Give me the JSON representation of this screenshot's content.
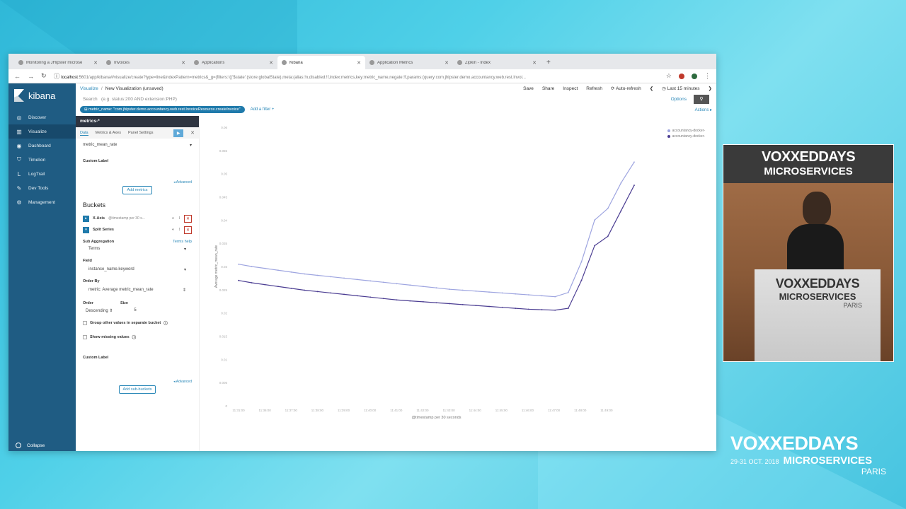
{
  "browser": {
    "tabs": [
      {
        "title": "Monitoring a JHipster microse",
        "active": false
      },
      {
        "title": "Invoices",
        "active": false
      },
      {
        "title": "Applications",
        "active": false
      },
      {
        "title": "Kibana",
        "active": true
      },
      {
        "title": "Application Metrics",
        "active": false
      },
      {
        "title": "Zipkin - Index",
        "active": false
      }
    ],
    "url_host": "localhost",
    "url_rest": ":5601/app/kibana#/visualize/create?type=line&indexPattern=metrics&_g=(filters:!(('$state':(store:globalState),meta:(alias:!n,disabled:!f,index:metrics,key:metric_name,negate:!f,params:(query:com.jhipster.demo.accountancy.web.rest.Invoi..."
  },
  "kibana": {
    "logo": "kibana",
    "nav": [
      {
        "label": "Discover",
        "icon": "compass-icon"
      },
      {
        "label": "Visualize",
        "icon": "bar-chart-icon"
      },
      {
        "label": "Dashboard",
        "icon": "dashboard-icon"
      },
      {
        "label": "Timelion",
        "icon": "shield-icon"
      },
      {
        "label": "LogTrail",
        "icon": "l-icon"
      },
      {
        "label": "Dev Tools",
        "icon": "wrench-icon"
      },
      {
        "label": "Management",
        "icon": "gear-icon"
      }
    ],
    "collapse": "Collapse",
    "breadcrumb": {
      "link": "Visualize",
      "sep": "/",
      "current": "New Visualization (unsaved)"
    },
    "top_actions": {
      "save": "Save",
      "share": "Share",
      "inspect": "Inspect",
      "refresh": "Refresh",
      "auto_refresh": "Auto-refresh",
      "time": "Last 15 minutes"
    },
    "search": {
      "label": "Search",
      "placeholder": "(e.g. status:200 AND extension:PHP)",
      "options": "Options"
    },
    "filter": {
      "pill": "metric_name: \"com.jhipster.demo.accountancy.web.rest.InvoiceResource.createInvoice\"",
      "add": "Add a filter +",
      "actions": "Actions ▸"
    },
    "editor": {
      "index": "metrics-*",
      "tabs": [
        "Data",
        "Metrics & Axes",
        "Panel Settings"
      ],
      "metric_field": "metric_mean_rate",
      "custom_label": "Custom Label",
      "advanced": "◂ Advanced",
      "add_metrics": "Add metrics",
      "buckets_title": "Buckets",
      "xaxis_label": "X-Axis",
      "xaxis_sub": "@timestamp per 30 s...",
      "split_label": "Split Series",
      "sub_aggregation": "Sub Aggregation",
      "terms_help": "Terms help",
      "sub_agg_value": "Terms",
      "field_label": "Field",
      "field_value": "instance_name.keyword",
      "order_by_label": "Order By",
      "order_by_value": "metric: Average metric_mean_rate",
      "order_label": "Order",
      "size_label": "Size",
      "order_value": "Descending",
      "size_value": "5",
      "group_other": "Group other values in separate bucket",
      "show_missing": "Show missing values",
      "custom_label2": "Custom Label",
      "advanced2": "◂ Advanced",
      "add_sub_buckets": "Add sub-buckets"
    }
  },
  "chart_data": {
    "type": "line",
    "ylabel": "Average metric_mean_rate",
    "xlabel": "@timestamp per 30 seconds",
    "ylim": [
      0,
      0.06
    ],
    "yticks": [
      "0.06",
      "0.055",
      "0.05",
      "0.045",
      "0.04",
      "0.035",
      "0.03",
      "0.025",
      "0.02",
      "0.015",
      "0.01",
      "0.005",
      "0"
    ],
    "xticks": [
      "11:31:00",
      "11:36:00",
      "11:37:00",
      "11:38:00",
      "11:39:00",
      "11:40:00",
      "11:41:00",
      "11:42:00",
      "11:43:00",
      "11:44:00",
      "11:45:00",
      "11:46:00",
      "11:47:00",
      "11:48:00",
      "11:49:00"
    ],
    "x_count": 31,
    "series": [
      {
        "name": "accountancy-docker-",
        "color": "#9ea5e0",
        "values": [
          0.0305,
          0.03,
          0.0296,
          0.0292,
          0.0288,
          0.0284,
          0.0281,
          0.0278,
          0.0275,
          0.0272,
          0.0269,
          0.0266,
          0.0263,
          0.026,
          0.0257,
          0.0254,
          0.0251,
          0.0249,
          0.0247,
          0.0245,
          0.0243,
          0.0241,
          0.0239,
          0.0237,
          0.0235,
          0.0244,
          0.031,
          0.04,
          0.0425,
          0.048,
          0.0525
        ]
      },
      {
        "name": "accountancy-docker-",
        "color": "#4b3d92",
        "values": [
          0.027,
          0.0265,
          0.0261,
          0.0257,
          0.0253,
          0.0249,
          0.0246,
          0.0243,
          0.024,
          0.0237,
          0.0234,
          0.0231,
          0.0228,
          0.0226,
          0.0224,
          0.0222,
          0.022,
          0.0218,
          0.0216,
          0.0214,
          0.0212,
          0.021,
          0.0208,
          0.0207,
          0.0206,
          0.021,
          0.027,
          0.0345,
          0.0365,
          0.042,
          0.0475
        ]
      }
    ]
  },
  "video": {
    "banner1": "VOXXEDDAYS",
    "banner2": "MICROSERVICES",
    "banner3": "PARIS",
    "podium1": "VOXXEDDAYS",
    "podium2": "MICROSERVICES",
    "podium3": "PARIS"
  },
  "conference": {
    "name": "VOXXEDDAYS",
    "date": "29-31 OCT. 2018",
    "micro": "MICROSERVICES",
    "city": "PARIS"
  }
}
